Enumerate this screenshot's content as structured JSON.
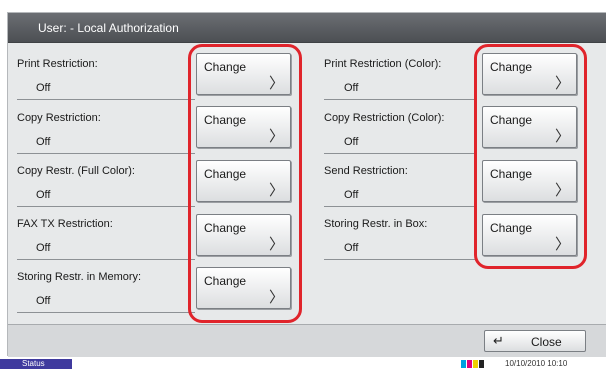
{
  "window": {
    "title": "User: - Local Authorization"
  },
  "restrictions_left": [
    {
      "label": "Print Restriction:",
      "value": "Off",
      "button": "Change"
    },
    {
      "label": "Copy Restriction:",
      "value": "Off",
      "button": "Change"
    },
    {
      "label": "Copy Restr. (Full Color):",
      "value": "Off",
      "button": "Change"
    },
    {
      "label": "FAX TX Restriction:",
      "value": "Off",
      "button": "Change"
    },
    {
      "label": "Storing Restr. in Memory:",
      "value": "Off",
      "button": "Change"
    }
  ],
  "restrictions_right": [
    {
      "label": "Print Restriction (Color):",
      "value": "Off",
      "button": "Change"
    },
    {
      "label": "Copy Restriction (Color):",
      "value": "Off",
      "button": "Change"
    },
    {
      "label": "Send Restriction:",
      "value": "Off",
      "button": "Change"
    },
    {
      "label": "Storing Restr. in Box:",
      "value": "Off",
      "button": "Change"
    }
  ],
  "icons": {
    "chevron": "chevron-right-icon",
    "close": "return-arrow-icon",
    "toner": "toner-level-icon"
  },
  "footer": {
    "close_label": "Close"
  },
  "status_bar": {
    "status_label": "Status",
    "datetime": "10/10/2010  10:10"
  },
  "colors": {
    "highlight": "#e0242b",
    "header": "#5c5f63",
    "status_tab": "#3f3a9e",
    "toner": [
      "#00a0e0",
      "#e0007a",
      "#f0d000",
      "#222222"
    ]
  }
}
